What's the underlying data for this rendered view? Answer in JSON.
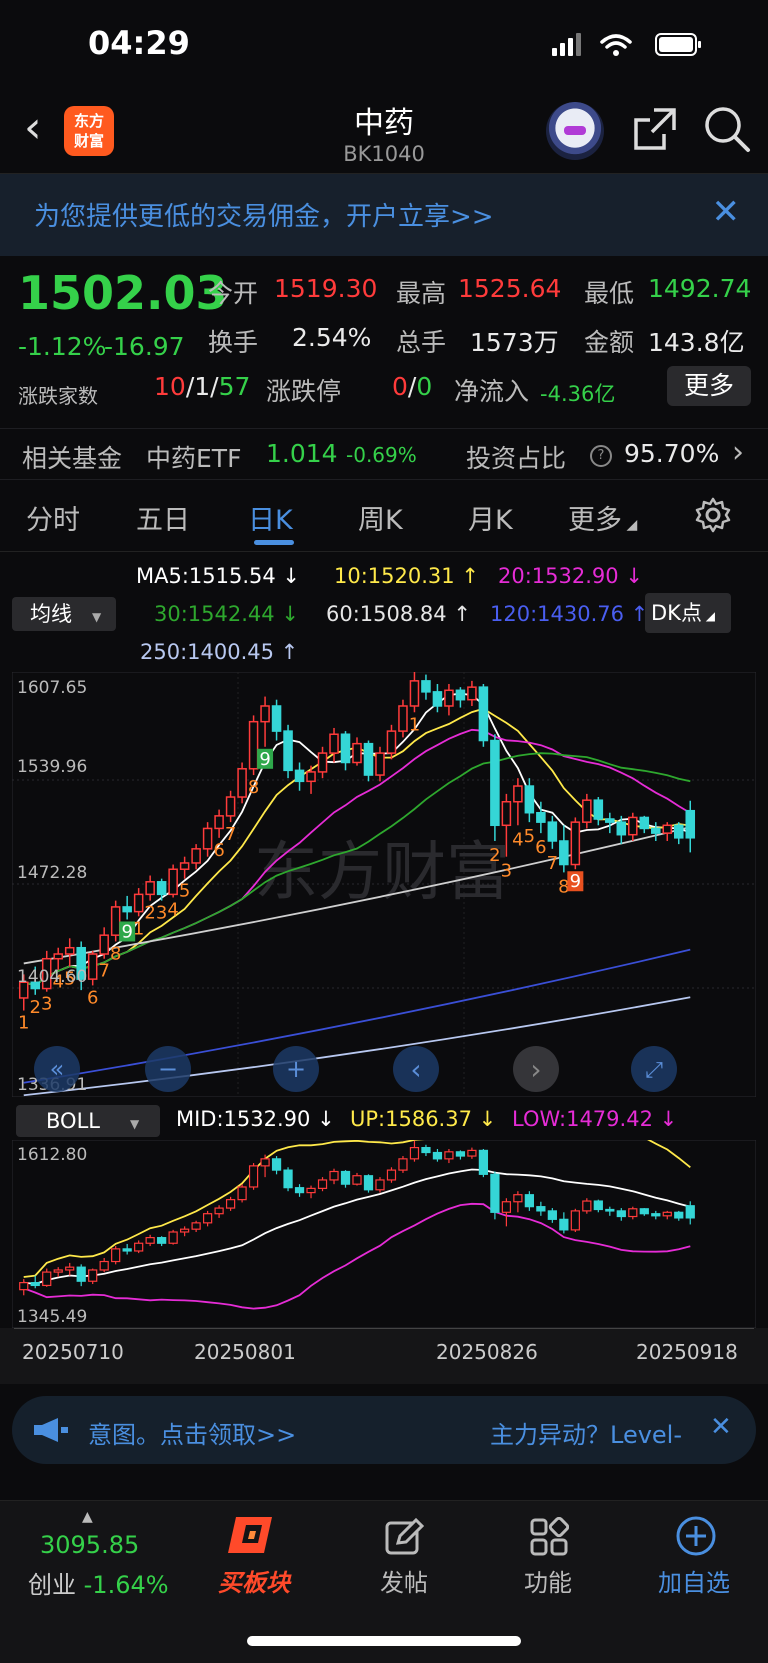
{
  "status_bar": {
    "time": "04:29"
  },
  "header": {
    "back_glyph": "‹",
    "logo_text_1": "东方",
    "logo_text_2": "财富",
    "title": "中药",
    "code": "BK1040"
  },
  "banner": {
    "text": "为您提供更低的交易佣金，开户立享>>",
    "close": "✕"
  },
  "quote": {
    "price": "1502.03",
    "change_pct": "-1.12%",
    "change_abs": "-16.97",
    "open_label": "今开",
    "open": "1519.30",
    "high_label": "最高",
    "high": "1525.64",
    "low_label": "最低",
    "low": "1492.74",
    "turnover_label": "换手",
    "turnover": "2.54%",
    "volume_label": "总手",
    "volume": "1573万",
    "amount_label": "金额",
    "amount": "143.8亿",
    "breadth_label": "涨跌家数",
    "breadth_up": "10",
    "breadth_sep1": "/",
    "breadth_flat": "1",
    "breadth_sep2": "/",
    "breadth_down": "57",
    "limit_label": "涨跌停",
    "limit_up": "0",
    "limit_sep": "/",
    "limit_down": "0",
    "inflow_label": "净流入",
    "inflow": "-4.36亿",
    "more_button": "更多"
  },
  "fund": {
    "label": "相关基金",
    "name": "中药ETF",
    "price": "1.014",
    "change": "-0.69%",
    "ratio_label": "投资占比",
    "ratio": "95.70%"
  },
  "tabs": [
    "分时",
    "五日",
    "日K",
    "周K",
    "月K",
    "更多"
  ],
  "active_tab": 2,
  "indicators": {
    "selector": "均线",
    "dk_button": "DK点",
    "ma5": "MA5:1515.54 ↓",
    "ma10": "10:1520.31 ↑",
    "ma20": "20:1532.90 ↓",
    "ma30": "30:1542.44 ↓",
    "ma60": "60:1508.84 ↑",
    "ma120": "120:1430.76 ↑",
    "ma250": "250:1400.45 ↑"
  },
  "colors": {
    "ma5": "#ffffff",
    "ma10": "#ffe94a",
    "ma20": "#e62cd6",
    "ma30": "#2ea82e",
    "ma60": "#cfcfcf",
    "ma120": "#3a4fd6",
    "ma250": "#b8c8f0",
    "up": "#ff3b3b",
    "down": "#35d6d6",
    "accent": "#4a8fe0"
  },
  "main_axis": {
    "top": "1607.65",
    "mid": "1539.96",
    "low": "1472.28",
    "lower": "1404.60",
    "bottom": "1336.91"
  },
  "chart_controls": [
    "«",
    "−",
    "+",
    "‹",
    "›",
    "⤢"
  ],
  "boll": {
    "selector": "BOLL",
    "mid": "MID:1532.90 ↓",
    "up": "UP:1586.37 ↓",
    "low": "LOW:1479.42 ↓",
    "axis_top": "1612.80",
    "axis_bottom": "1345.49"
  },
  "dates": [
    "20250710",
    "20250801",
    "20250826",
    "20250918"
  ],
  "watermark": "东方财富",
  "ticker": {
    "left_text": "意图。点击领取>>",
    "right_text": "主力异动？Level-",
    "close": "✕"
  },
  "tabbar": {
    "index_value": "3095.85",
    "index_name": "创业",
    "index_change": "-1.64%",
    "buy_block": "买板块",
    "post": "发帖",
    "function": "功能",
    "add": "加自选"
  },
  "chart_data": {
    "type": "candlestick",
    "title": "",
    "x": [
      "20250710",
      "20250801",
      "20250826",
      "20250918"
    ],
    "ylim": [
      1336.91,
      1607.65
    ],
    "series": [
      {
        "name": "MA5",
        "values": [
          1515.54
        ]
      },
      {
        "name": "10",
        "values": [
          1520.31
        ]
      },
      {
        "name": "20",
        "values": [
          1532.9
        ]
      },
      {
        "name": "30",
        "values": [
          1542.44
        ]
      },
      {
        "name": "60",
        "values": [
          1508.84
        ]
      },
      {
        "name": "120",
        "values": [
          1430.76
        ]
      },
      {
        "name": "250",
        "values": [
          1400.45
        ]
      }
    ],
    "candles": [
      [
        1400,
        1415,
        1392,
        1410
      ],
      [
        1410,
        1420,
        1402,
        1406
      ],
      [
        1406,
        1430,
        1404,
        1425
      ],
      [
        1425,
        1432,
        1418,
        1428
      ],
      [
        1428,
        1438,
        1420,
        1432
      ],
      [
        1432,
        1436,
        1405,
        1412
      ],
      [
        1412,
        1430,
        1408,
        1428
      ],
      [
        1428,
        1445,
        1425,
        1440
      ],
      [
        1440,
        1462,
        1436,
        1458
      ],
      [
        1458,
        1465,
        1450,
        1455
      ],
      [
        1455,
        1470,
        1452,
        1466
      ],
      [
        1466,
        1478,
        1462,
        1474
      ],
      [
        1474,
        1476,
        1462,
        1466
      ],
      [
        1466,
        1485,
        1464,
        1482
      ],
      [
        1482,
        1490,
        1476,
        1486
      ],
      [
        1486,
        1498,
        1482,
        1495
      ],
      [
        1495,
        1512,
        1490,
        1508
      ],
      [
        1508,
        1520,
        1502,
        1516
      ],
      [
        1516,
        1532,
        1512,
        1528
      ],
      [
        1528,
        1550,
        1524,
        1546
      ],
      [
        1546,
        1580,
        1542,
        1576
      ],
      [
        1576,
        1592,
        1560,
        1586
      ],
      [
        1586,
        1590,
        1564,
        1570
      ],
      [
        1570,
        1574,
        1540,
        1545
      ],
      [
        1545,
        1550,
        1532,
        1538
      ],
      [
        1538,
        1548,
        1530,
        1544
      ],
      [
        1544,
        1560,
        1540,
        1556
      ],
      [
        1556,
        1572,
        1550,
        1568
      ],
      [
        1568,
        1570,
        1545,
        1550
      ],
      [
        1550,
        1566,
        1548,
        1562
      ],
      [
        1562,
        1564,
        1538,
        1542
      ],
      [
        1542,
        1560,
        1538,
        1556
      ],
      [
        1556,
        1574,
        1552,
        1570
      ],
      [
        1570,
        1590,
        1566,
        1586
      ],
      [
        1586,
        1612,
        1582,
        1602
      ],
      [
        1602,
        1606,
        1590,
        1595
      ],
      [
        1595,
        1600,
        1582,
        1586
      ],
      [
        1586,
        1600,
        1580,
        1596
      ],
      [
        1596,
        1598,
        1585,
        1590
      ],
      [
        1590,
        1602,
        1586,
        1598
      ],
      [
        1598,
        1600,
        1560,
        1564
      ],
      [
        1564,
        1568,
        1500,
        1510
      ],
      [
        1510,
        1530,
        1490,
        1525
      ],
      [
        1525,
        1540,
        1510,
        1535
      ],
      [
        1535,
        1540,
        1512,
        1518
      ],
      [
        1518,
        1525,
        1505,
        1512
      ],
      [
        1512,
        1516,
        1495,
        1500
      ],
      [
        1500,
        1510,
        1480,
        1485
      ],
      [
        1485,
        1515,
        1482,
        1512
      ],
      [
        1512,
        1530,
        1508,
        1526
      ],
      [
        1526,
        1528,
        1510,
        1514
      ],
      [
        1514,
        1518,
        1505,
        1512
      ],
      [
        1512,
        1516,
        1498,
        1504
      ],
      [
        1504,
        1518,
        1500,
        1515
      ],
      [
        1515,
        1516,
        1505,
        1508
      ],
      [
        1508,
        1512,
        1500,
        1505
      ],
      [
        1505,
        1512,
        1500,
        1510
      ],
      [
        1510,
        1512,
        1498,
        1502
      ],
      [
        1519.3,
        1525.64,
        1492.74,
        1502.03
      ]
    ]
  }
}
